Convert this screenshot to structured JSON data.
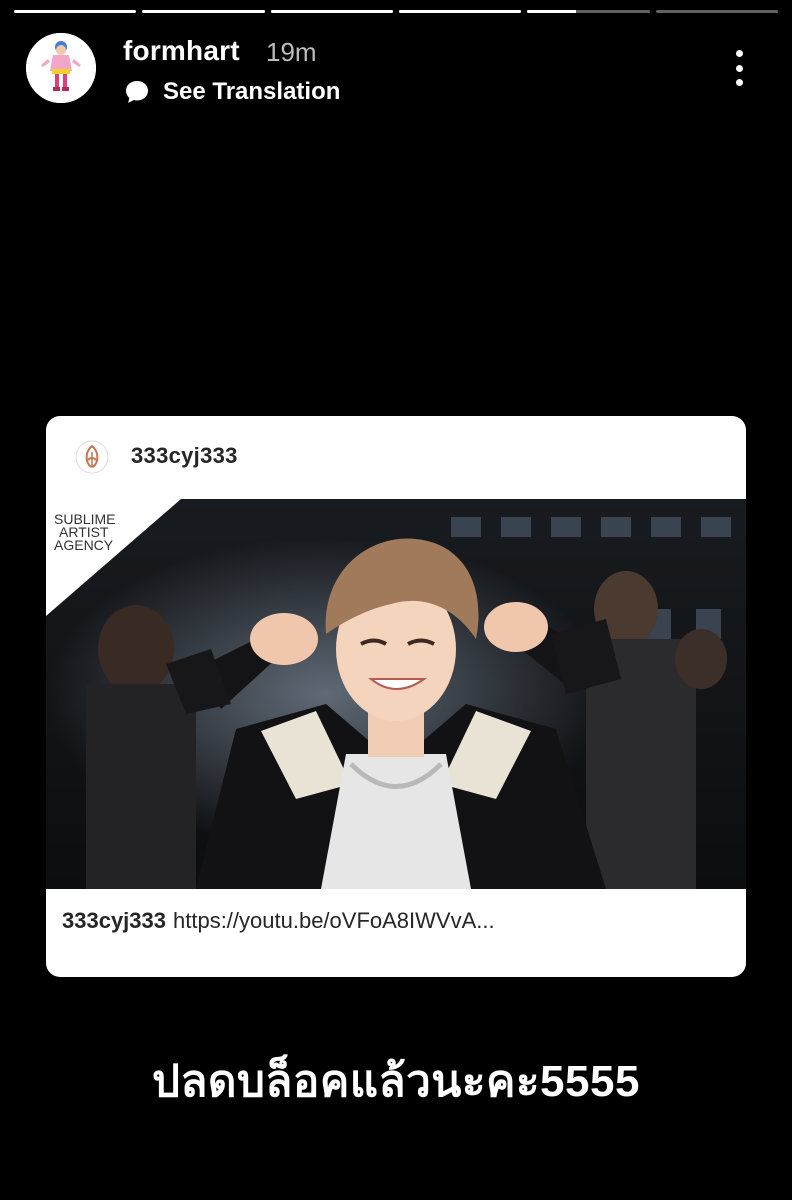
{
  "story": {
    "progress": [
      1,
      1,
      1,
      1,
      0.4,
      0
    ],
    "username": "formhart",
    "time": "19m",
    "see_translation": "See Translation",
    "more_icon": "more-vertical-icon",
    "text": "ปลดบล็อคแล้วนะคะ5555"
  },
  "shared_post": {
    "username": "333cyj333",
    "brand_lines": [
      "SUBLIME",
      "ARTIST",
      "AGENCY"
    ],
    "caption_user": "333cyj333",
    "caption_text": "https://youtu.be/oVFoA8IWVvA..."
  },
  "colors": {
    "background": "#000000",
    "card": "#ffffff",
    "logo_accent": "#c8734f",
    "text_dark": "#262626"
  }
}
